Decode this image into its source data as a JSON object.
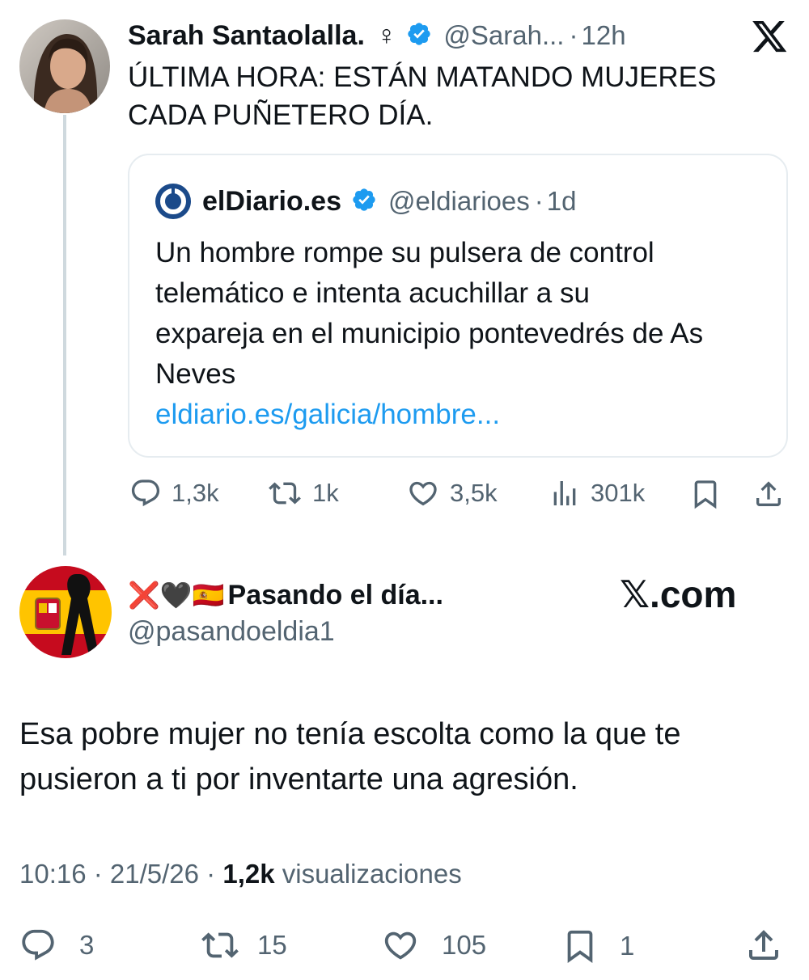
{
  "parent_tweet": {
    "display_name": "Sarah Santaolalla.",
    "name_symbol": "♀",
    "handle": "@Sarah...",
    "separator": "·",
    "time": "12h",
    "text_line1": "ÚLTIMA HORA: ESTÁN MATANDO MUJERES",
    "text_line2": "CADA PUÑETERO DÍA.",
    "quote": {
      "display_name": "elDiario.es",
      "handle": "@eldiarioes",
      "separator": "·",
      "time": "1d",
      "text_line1": "Un hombre rompe su pulsera de control",
      "text_line2": "telemático e intenta acuchillar a su",
      "text_line3": "expareja en el municipio pontevedrés de As",
      "text_line4": "Neves",
      "link": "eldiario.es/galicia/hombre..."
    },
    "actions": {
      "replies": "1,3k",
      "reposts": "1k",
      "likes": "3,5k",
      "views": "301k"
    }
  },
  "reply_tweet": {
    "display_name_emoji": "❌🖤🇪🇸",
    "display_name": "Pasando el día...",
    "handle": "@pasandoeldia1",
    "watermark": "𝕏.com",
    "text_line1": "Esa pobre mujer no tenía escolta como la que te",
    "text_line2": "pusieron a ti por inventarte una agresión.",
    "timestamp": "10:16 · 21/5/26 · ",
    "views_count": "1,2k",
    "views_label": " visualizaciones",
    "actions": {
      "replies": "3",
      "reposts": "15",
      "likes": "105",
      "bookmarks": "1"
    }
  },
  "icons": {
    "x_logo": "x-logo-icon",
    "verified": "verified-badge-icon",
    "reply": "reply-icon",
    "repost": "repost-icon",
    "like": "heart-icon",
    "views": "views-icon",
    "bookmark": "bookmark-icon",
    "share": "share-icon"
  },
  "colors": {
    "text": "#0f1419",
    "muted": "#536471",
    "link": "#1d9bf0",
    "verified": "#1d9bf0",
    "border": "#e6ecf0",
    "thread_line": "#cfd9de",
    "eldiario_blue": "#1b4a8a"
  }
}
